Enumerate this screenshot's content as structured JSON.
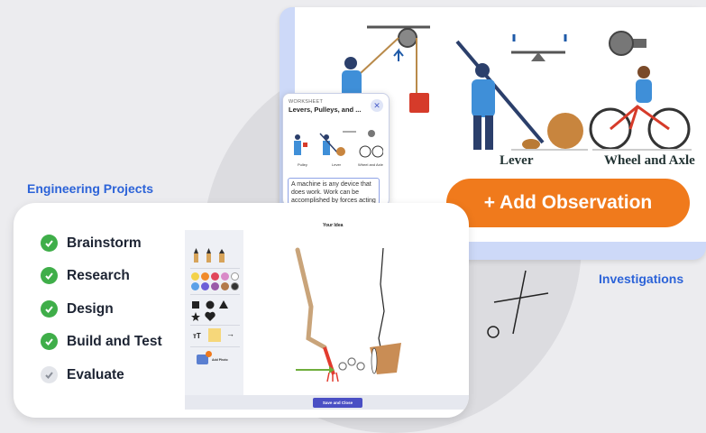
{
  "investigations": {
    "heading": "Investigations",
    "machines": [
      {
        "label": ""
      },
      {
        "label": "Lever"
      },
      {
        "label": "Wheel and Axle"
      }
    ],
    "add_observation_label": "+ Add Observation"
  },
  "worksheet": {
    "kicker": "WORKSHEET",
    "title": "Levers, Pulleys, and ...",
    "close": "✕",
    "captions": [
      "Pulley",
      "Lever",
      "Wheel and Axle"
    ],
    "text": "A machine is any device that does work. Work can be accomplished by forces acting"
  },
  "engineering": {
    "heading": "Engineering Projects",
    "steps": [
      {
        "label": "Brainstorm",
        "status": "done"
      },
      {
        "label": "Research",
        "status": "done"
      },
      {
        "label": "Design",
        "status": "done"
      },
      {
        "label": "Build and Test",
        "status": "done"
      },
      {
        "label": "Evaluate",
        "status": "pending"
      }
    ],
    "editor": {
      "title": "Your Idea",
      "text_tool": "тT",
      "add_photo": "Add Photo",
      "save_label": "Save and Close"
    }
  },
  "colors": {
    "brand_blue": "#2c63d8",
    "accent_orange": "#f07a1c",
    "check_green": "#3fae49",
    "check_gray": "#8a8f99",
    "save_button": "#4a4fc4"
  }
}
